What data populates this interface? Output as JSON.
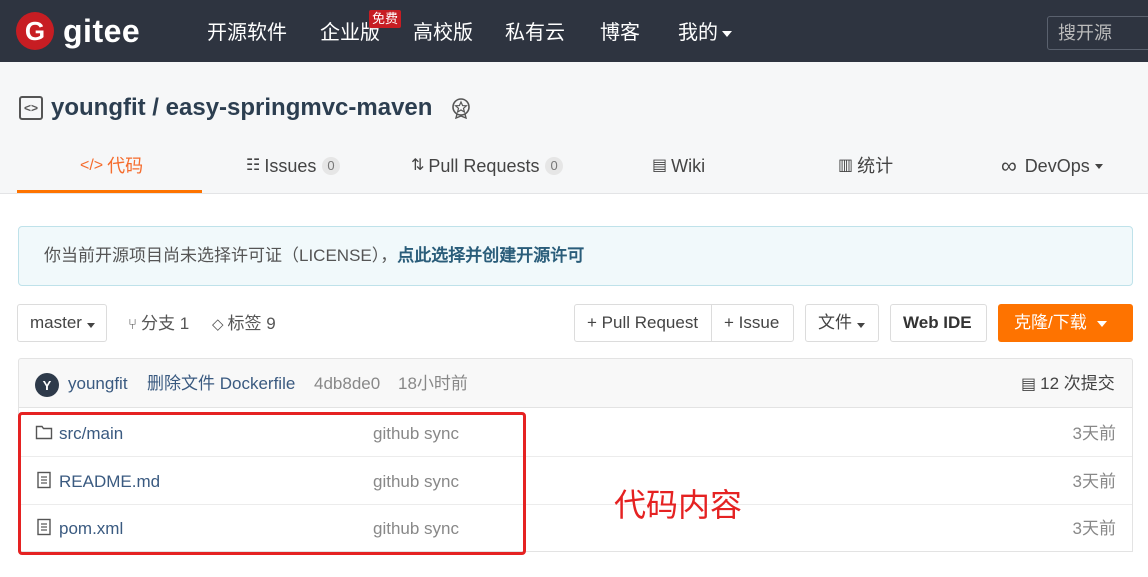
{
  "nav": {
    "logo_letter": "G",
    "logo_text": "gitee",
    "items": [
      {
        "label": "开源软件"
      },
      {
        "label": "企业版"
      },
      {
        "label": "高校版"
      },
      {
        "label": "私有云"
      },
      {
        "label": "博客"
      },
      {
        "label": "我的"
      }
    ],
    "enterprise_badge": "免费",
    "search_placeholder": "搜开源"
  },
  "repo": {
    "title": "youngfit / easy-springmvc-maven",
    "icon": "repo-code-icon",
    "tabs": [
      {
        "icon": "</>",
        "label": "代码",
        "active": true
      },
      {
        "icon": "☷",
        "label": "Issues",
        "count": "0"
      },
      {
        "icon": "⇅",
        "label": "Pull Requests",
        "count": "0"
      },
      {
        "icon": "▤",
        "label": "Wiki"
      },
      {
        "icon": "▥",
        "label": "统计"
      },
      {
        "icon": "∞",
        "label": "DevOps"
      }
    ]
  },
  "notice": {
    "text": "你当前开源项目尚未选择许可证（LICENSE），",
    "link": "点此选择并创建开源许可"
  },
  "toolbar": {
    "branch": "master",
    "branches": "分支 1",
    "tags": "标签 9",
    "pull_request": "+ Pull Request",
    "issue": "+ Issue",
    "file": "文件",
    "web_ide": "Web IDE",
    "clone": "克隆/下载"
  },
  "commit": {
    "avatar_letter": "Y",
    "author": "youngfit",
    "message": "删除文件 Dockerfile",
    "hash": "4db8de0",
    "time": "18小时前",
    "commits": "12 次提交"
  },
  "files": [
    {
      "type": "folder",
      "name": "src/main",
      "message": "github sync",
      "time": "3天前"
    },
    {
      "type": "file",
      "name": "README.md",
      "message": "github sync",
      "time": "3天前"
    },
    {
      "type": "file",
      "name": "pom.xml",
      "message": "github sync",
      "time": "3天前"
    }
  ],
  "annotation": "代码内容",
  "colors": {
    "accent": "#fe7300",
    "nav_bg": "#2e3440",
    "annotation": "#e52222",
    "brand": "#c71d23"
  }
}
